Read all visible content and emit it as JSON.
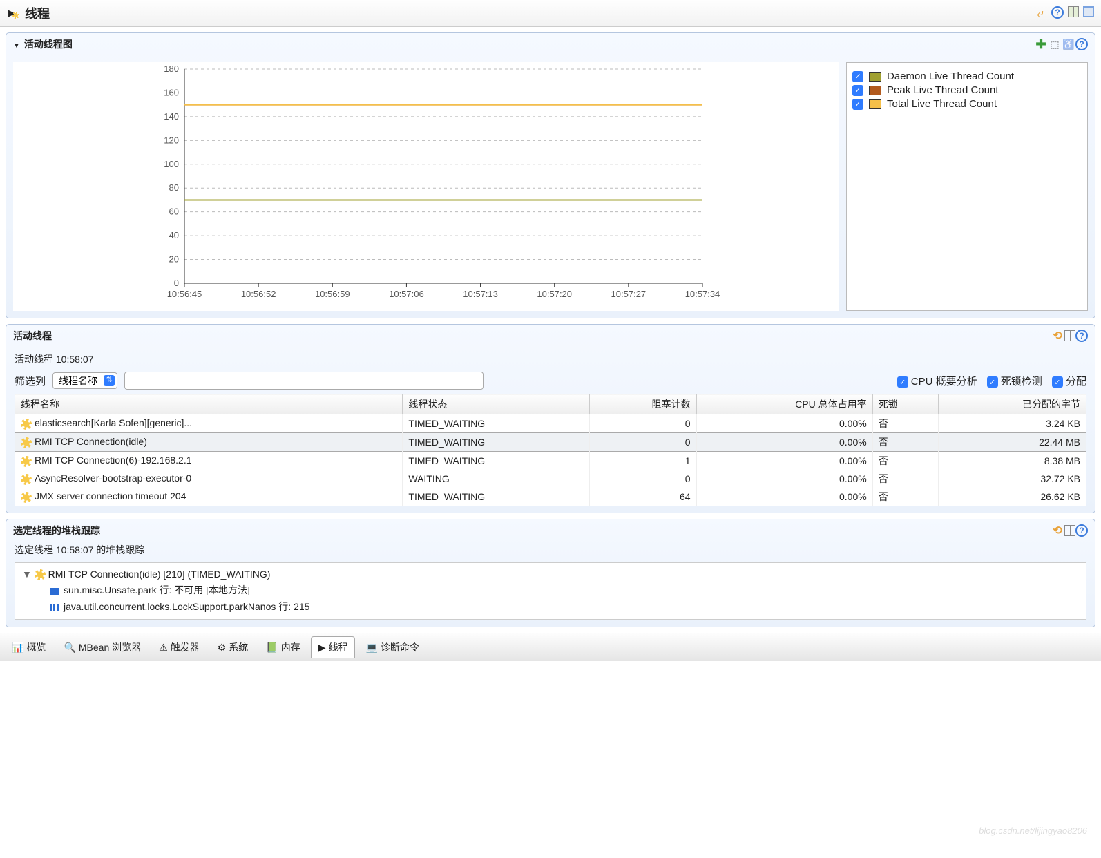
{
  "header": {
    "title": "线程"
  },
  "chartPanel": {
    "title": "活动线程图",
    "legend": [
      {
        "label": "Daemon Live Thread Count",
        "color": "#a0a030"
      },
      {
        "label": "Peak Live Thread Count",
        "color": "#b25a1e"
      },
      {
        "label": "Total Live Thread Count",
        "color": "#f5c04a"
      }
    ]
  },
  "chart_data": {
    "type": "line",
    "xlabel": "",
    "ylabel": "",
    "ylim": [
      0,
      180
    ],
    "yticks": [
      0,
      20,
      40,
      60,
      80,
      100,
      120,
      140,
      160,
      180
    ],
    "x": [
      "10:56:45",
      "10:56:52",
      "10:56:59",
      "10:57:06",
      "10:57:13",
      "10:57:20",
      "10:57:27",
      "10:57:34"
    ],
    "series": [
      {
        "name": "Daemon Live Thread Count",
        "color": "#a0a030",
        "values": [
          70,
          70,
          70,
          70,
          70,
          70,
          70,
          70
        ]
      },
      {
        "name": "Peak Live Thread Count",
        "color": "#b25a1e",
        "values": [
          150,
          150,
          150,
          150,
          150,
          150,
          150,
          150
        ]
      },
      {
        "name": "Total Live Thread Count",
        "color": "#f5c04a",
        "values": [
          150,
          150,
          150,
          150,
          150,
          150,
          150,
          150
        ]
      }
    ]
  },
  "threadsPanel": {
    "title": "活动线程",
    "timestamp": "活动线程 10:58:07",
    "filterLabel": "筛选列",
    "filterSelect": "线程名称",
    "checks": {
      "cpu": "CPU 概要分析",
      "deadlock": "死锁检测",
      "alloc": "分配"
    },
    "columns": [
      "线程名称",
      "线程状态",
      "阻塞计数",
      "CPU 总体占用率",
      "死锁",
      "已分配的字节"
    ],
    "rows": [
      {
        "name": "elasticsearch[Karla Sofen][generic]...",
        "state": "TIMED_WAITING",
        "blocked": "0",
        "cpu": "0.00%",
        "dead": "否",
        "bytes": "3.24 KB"
      },
      {
        "name": "RMI TCP Connection(idle)",
        "state": "TIMED_WAITING",
        "blocked": "0",
        "cpu": "0.00%",
        "dead": "否",
        "bytes": "22.44 MB",
        "selected": true
      },
      {
        "name": "RMI TCP Connection(6)-192.168.2.1",
        "state": "TIMED_WAITING",
        "blocked": "1",
        "cpu": "0.00%",
        "dead": "否",
        "bytes": "8.38 MB"
      },
      {
        "name": "AsyncResolver-bootstrap-executor-0",
        "state": "WAITING",
        "blocked": "0",
        "cpu": "0.00%",
        "dead": "否",
        "bytes": "32.72 KB"
      },
      {
        "name": "JMX server connection timeout 204",
        "state": "TIMED_WAITING",
        "blocked": "64",
        "cpu": "0.00%",
        "dead": "否",
        "bytes": "26.62 KB"
      }
    ]
  },
  "stackPanel": {
    "title": "选定线程的堆栈跟踪",
    "subtitle": "选定线程 10:58:07 的堆栈跟踪",
    "root": "RMI TCP Connection(idle) [210] (TIMED_WAITING)",
    "frames": [
      "sun.misc.Unsafe.park 行: 不可用 [本地方法]",
      "java.util.concurrent.locks.LockSupport.parkNanos 行: 215"
    ]
  },
  "tabs": [
    {
      "label": "概览"
    },
    {
      "label": "MBean 浏览器"
    },
    {
      "label": "触发器"
    },
    {
      "label": "系统"
    },
    {
      "label": "内存"
    },
    {
      "label": "线程",
      "active": true
    },
    {
      "label": "诊断命令"
    }
  ],
  "watermark": "blog.csdn.net/lijingyao8206"
}
